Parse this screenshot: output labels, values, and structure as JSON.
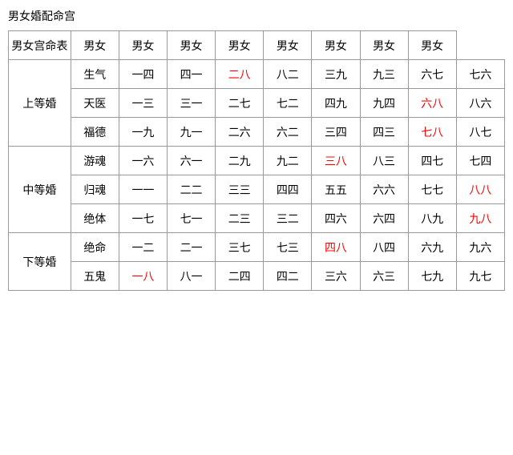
{
  "title": "男女婚配命宫",
  "table": {
    "col_headers": [
      "男女宫命表",
      "男女",
      "男女",
      "男女",
      "男女",
      "男女",
      "男女",
      "男女",
      "男女"
    ],
    "sections": [
      {
        "group": "上等婚",
        "rows": [
          {
            "sub": "生气",
            "cells": [
              "一四",
              "四一",
              {
                "val": "二八",
                "red": true
              },
              "八二",
              "三九",
              "九三",
              "六七",
              "七六"
            ]
          },
          {
            "sub": "天医",
            "cells": [
              "一三",
              "三一",
              "二七",
              "七二",
              "四九",
              "九四",
              {
                "val": "六八",
                "red": true
              },
              "八六"
            ]
          },
          {
            "sub": "福德",
            "cells": [
              "一九",
              "九一",
              "二六",
              "六二",
              "三四",
              "四三",
              {
                "val": "七八",
                "red": true
              },
              "八七"
            ]
          }
        ]
      },
      {
        "group": "中等婚",
        "rows": [
          {
            "sub": "游魂",
            "cells": [
              "一六",
              "六一",
              "二九",
              "九二",
              {
                "val": "三八",
                "red": true
              },
              "八三",
              "四七",
              "七四"
            ]
          },
          {
            "sub": "归魂",
            "cells": [
              "一一",
              "二二",
              "三三",
              "四四",
              "五五",
              "六六",
              "七七",
              {
                "val": "八八",
                "red": true
              }
            ]
          },
          {
            "sub": "绝体",
            "cells": [
              "一七",
              "七一",
              "二三",
              "三二",
              "四六",
              "六四",
              "八九",
              {
                "val": "九八",
                "red": true
              }
            ]
          }
        ]
      },
      {
        "group": "下等婚",
        "rows": [
          {
            "sub": "绝命",
            "cells": [
              "一二",
              "二一",
              "三七",
              "七三",
              {
                "val": "四八",
                "red": true
              },
              "八四",
              "六九",
              "九六"
            ]
          },
          {
            "sub": "五鬼",
            "cells": [
              {
                "val": "一八",
                "red": true
              },
              "八一",
              "二四",
              "四二",
              "三六",
              "六三",
              "七九",
              "九七"
            ]
          }
        ]
      }
    ]
  }
}
